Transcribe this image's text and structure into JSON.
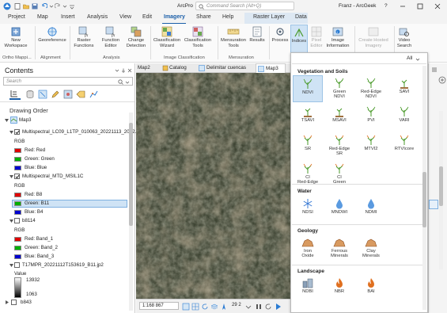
{
  "app": {
    "title": "ArcPro",
    "search_placeholder": "Command Search (Alt+Q)",
    "user": "Franz - ArcGeek",
    "help": "?"
  },
  "tabs": [
    "Project",
    "Map",
    "Insert",
    "Analysis",
    "View",
    "Edit",
    "Imagery",
    "Share",
    "Help",
    "Raster Layer",
    "Data"
  ],
  "ribbon": {
    "new_workspace": "New\nWorkspace",
    "workspace_sub": "Ortho Mappi...",
    "georeference": "Georeference",
    "alignment": "Alignment",
    "raster_functions": "Raster\nFunctions",
    "function_editor": "Function\nEditor",
    "change_detection": "Change\nDetection",
    "analysis": "Analysis",
    "classification_wizard": "Classification\nWizard",
    "classification_tools": "Classification\nTools",
    "image_classification": "Image Classification",
    "mensuration_tools": "Mensuration\nTools",
    "results": "Results",
    "mensuration": "Mensuration",
    "process": "Process",
    "indices": "Indices",
    "pixel_editor": "Pixel\nEditor",
    "image_information": "Image\nInformation",
    "create_hosted_imagery": "Create Hosted\nImagery",
    "video_search": "Video\nSearch"
  },
  "contents": {
    "title": "Contents",
    "search_placeholder": "Search",
    "drawing_order": "Drawing Order",
    "map_name": "Map3",
    "layers": [
      {
        "name": "Multispectral_LC09_L1TP_010063_20221113_2022...",
        "checked": true,
        "type": "RGB",
        "bands": [
          {
            "label": "Red:  Red",
            "color": "#e00000"
          },
          {
            "label": "Green: Green",
            "color": "#00b000"
          },
          {
            "label": "Blue:  Blue",
            "color": "#0000d0"
          }
        ]
      },
      {
        "name": "Multispectral_MTD_MSIL1C",
        "checked": true,
        "type": "RGB",
        "bands": [
          {
            "label": "Red:  B8",
            "color": "#e00000"
          },
          {
            "label": "Green: B11",
            "color": "#00b000"
          },
          {
            "label": "Blue:  B4",
            "color": "#0000d0"
          }
        ]
      },
      {
        "name": "b8114",
        "checked": false,
        "type": "RGB",
        "bands": [
          {
            "label": "Red:  Band_1",
            "color": "#e00000"
          },
          {
            "label": "Green: Band_2",
            "color": "#00b000"
          },
          {
            "label": "Blue:  Band_3",
            "color": "#0000d0"
          }
        ]
      },
      {
        "name": "T17MPR_20221112T153619_B11.jp2",
        "checked": false,
        "type": "Value",
        "max": "13932",
        "min": "1063"
      },
      {
        "name": "b843",
        "checked": false
      }
    ]
  },
  "map_tabs": [
    "Map2",
    "Catalog",
    "Delimitar cuencas",
    "Map3"
  ],
  "map_status": {
    "scale": "1:168 867",
    "coord": "29 2"
  },
  "gallery": {
    "filter": "All",
    "sections": [
      {
        "title": "Vegetation and Soils",
        "items": [
          "NDVI",
          "Green\nNDVI",
          "Red-Edge\nNDVI",
          "SAVI",
          "TSAVI",
          "MSAVI",
          "PVI",
          "VARI",
          "SR",
          "Red-Edge\nSR",
          "MTVI2",
          "RTVIcore",
          "CI\nRed-Edge",
          "CI\nGreen"
        ]
      },
      {
        "title": "Water",
        "items": [
          "NDSI",
          "MNDWI",
          "NDMI"
        ]
      },
      {
        "title": "Geology",
        "items": [
          "Iron\nOxide",
          "Ferrous\nMinerals",
          "Clay\nMinerals"
        ]
      },
      {
        "title": "Landscape",
        "items": [
          "NDBI",
          "NBR",
          "BAI"
        ]
      }
    ]
  },
  "colors": {
    "accent": "#1a5ea8",
    "selected": "#cfe3f5",
    "vegetation_icon": "#4a9a2a",
    "water_icon": "#3a7bd5",
    "geology_icon": "#c07840",
    "fire_icon": "#e07020"
  }
}
